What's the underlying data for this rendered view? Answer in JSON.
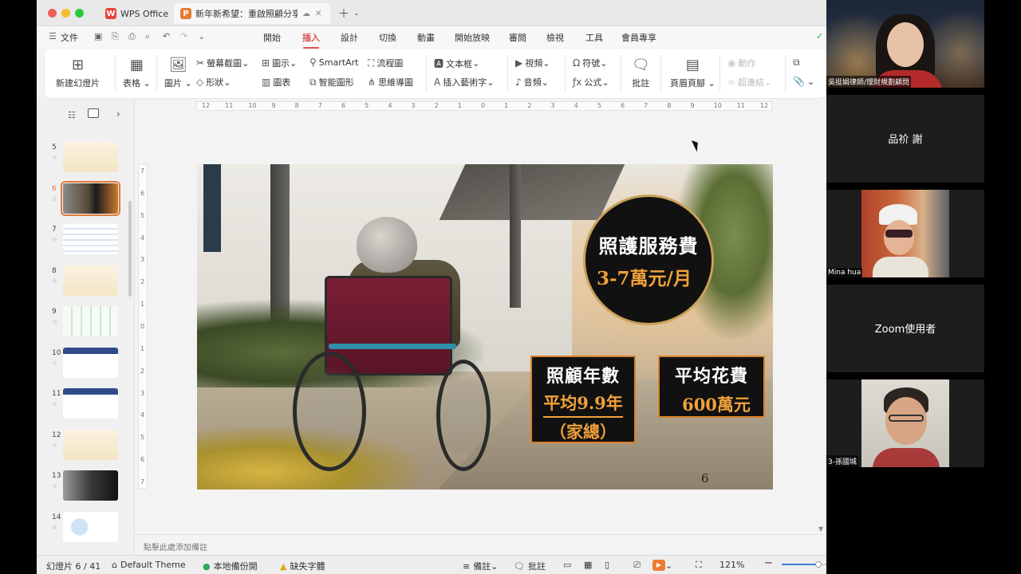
{
  "tabs": {
    "wps_label": "WPS Office",
    "doc_label": "新年新希望：重啟照顧分享"
  },
  "menu": {
    "file_label": "文件",
    "items": [
      "開始",
      "插入",
      "設計",
      "切換",
      "動畫",
      "開始放映",
      "審閱",
      "檢視",
      "工具",
      "會員專享"
    ],
    "active": "插入"
  },
  "ribbon": {
    "new_slide": "新建幻燈片",
    "table": "表格",
    "picture": "圖片",
    "screenshot": "螢幕截圖",
    "shape": "形狀",
    "icon": "圖示",
    "chart": "圖表",
    "smartart": "SmartArt",
    "smart_shape": "智能圖形",
    "flowchart": "流程圖",
    "mindmap": "思維導圖",
    "textbox": "文本框",
    "wordart": "插入藝術字",
    "video": "視頻",
    "audio": "音頻",
    "symbol": "符號",
    "formula": "公式",
    "comment": "批註",
    "header_footer": "頁眉頁腳",
    "action": "動作",
    "hyperlink": "超連結"
  },
  "ruler": {
    "h_labels": [
      "12",
      "11",
      "10",
      "9",
      "8",
      "7",
      "6",
      "5",
      "4",
      "3",
      "2",
      "1",
      "0",
      "1",
      "2",
      "3",
      "4",
      "5",
      "6",
      "7",
      "8",
      "9",
      "10",
      "11",
      "12"
    ],
    "v_labels": [
      "7",
      "6",
      "5",
      "4",
      "3",
      "2",
      "1",
      "0",
      "1",
      "2",
      "3",
      "4",
      "5",
      "6",
      "7"
    ]
  },
  "thumbs": [
    {
      "num": "5",
      "style": "cream"
    },
    {
      "num": "6",
      "style": "photo",
      "selected": true
    },
    {
      "num": "7",
      "style": "table"
    },
    {
      "num": "8",
      "style": "cream"
    },
    {
      "num": "9",
      "style": "table2"
    },
    {
      "num": "10",
      "style": "bluetable"
    },
    {
      "num": "11",
      "style": "bluetable"
    },
    {
      "num": "12",
      "style": "cream"
    },
    {
      "num": "13",
      "style": "dark"
    },
    {
      "num": "14",
      "style": "diagram"
    }
  ],
  "slide": {
    "circle_title": "照護服務費",
    "circle_value": "3-7萬元/月",
    "box1_title": "照顧年數",
    "box1_value": "平均9.9年",
    "box1_note": "（家總）",
    "box2_title": "平均花費",
    "box2_value": "600萬元",
    "page_number": "6"
  },
  "notes_placeholder": "點擊此處添加備註",
  "status": {
    "slide_count": "幻燈片 6 / 41",
    "theme": "Default Theme",
    "backup": "本地備份開",
    "missing_font": "缺失字體",
    "notes": "備註",
    "comments": "批註",
    "zoom": "121%"
  },
  "participants": [
    {
      "name": "吳挺娟律師/理財規劃顧問",
      "video": true
    },
    {
      "name": "品祄 謝",
      "video": false
    },
    {
      "name": "Mina hua",
      "video": true
    },
    {
      "name": "Zoom使用者",
      "video": false
    },
    {
      "name": "3-孫國城",
      "video": true
    }
  ],
  "colors": {
    "accent_red": "#d9534f",
    "slide_orange": "#f0a13a",
    "selection": "#e07b39"
  }
}
